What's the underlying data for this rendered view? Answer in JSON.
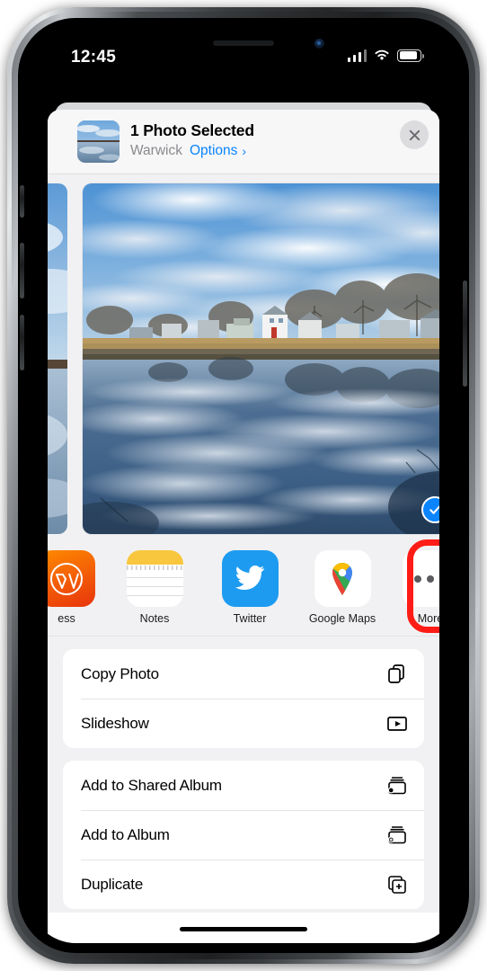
{
  "status_bar": {
    "time": "12:45",
    "signal_icon": "cellular-signal-icon",
    "wifi_icon": "wifi-icon",
    "battery_icon": "battery-icon"
  },
  "share_sheet": {
    "header": {
      "title": "1 Photo Selected",
      "album": "Warwick",
      "options_label": "Options",
      "chevron": "›",
      "close_icon": "close-icon",
      "thumbnail_alt": "selected-photo-thumbnail"
    },
    "photo": {
      "selected_badge_icon": "checkmark-circle-icon",
      "description": "Winter landscape with houses and bare trees reflected in still water"
    },
    "apps": [
      {
        "label": "ess",
        "icon": "wordpress-app-icon",
        "truncated": true
      },
      {
        "label": "Notes",
        "icon": "notes-app-icon"
      },
      {
        "label": "Twitter",
        "icon": "twitter-app-icon"
      },
      {
        "label": "Google Maps",
        "icon": "google-maps-app-icon"
      },
      {
        "label": "More",
        "icon": "more-ellipsis-icon",
        "highlighted": true
      }
    ],
    "action_groups": [
      {
        "rows": [
          {
            "label": "Copy Photo",
            "icon": "copy-icon"
          },
          {
            "label": "Slideshow",
            "icon": "play-rectangle-icon"
          }
        ]
      },
      {
        "rows": [
          {
            "label": "Add to Shared Album",
            "icon": "shared-album-person-icon"
          },
          {
            "label": "Add to Album",
            "icon": "add-to-album-plus-icon"
          },
          {
            "label": "Duplicate",
            "icon": "duplicate-squares-icon"
          }
        ]
      }
    ]
  },
  "annotation": {
    "highlight_color": "#ff1c16",
    "highlight_target": "More"
  },
  "colors": {
    "accent_blue": "#0a84ff",
    "sheet_background": "#f1f1f3",
    "row_background": "#ffffff",
    "secondary_text": "#8a8a8e"
  },
  "home_indicator": "home-indicator-bar"
}
